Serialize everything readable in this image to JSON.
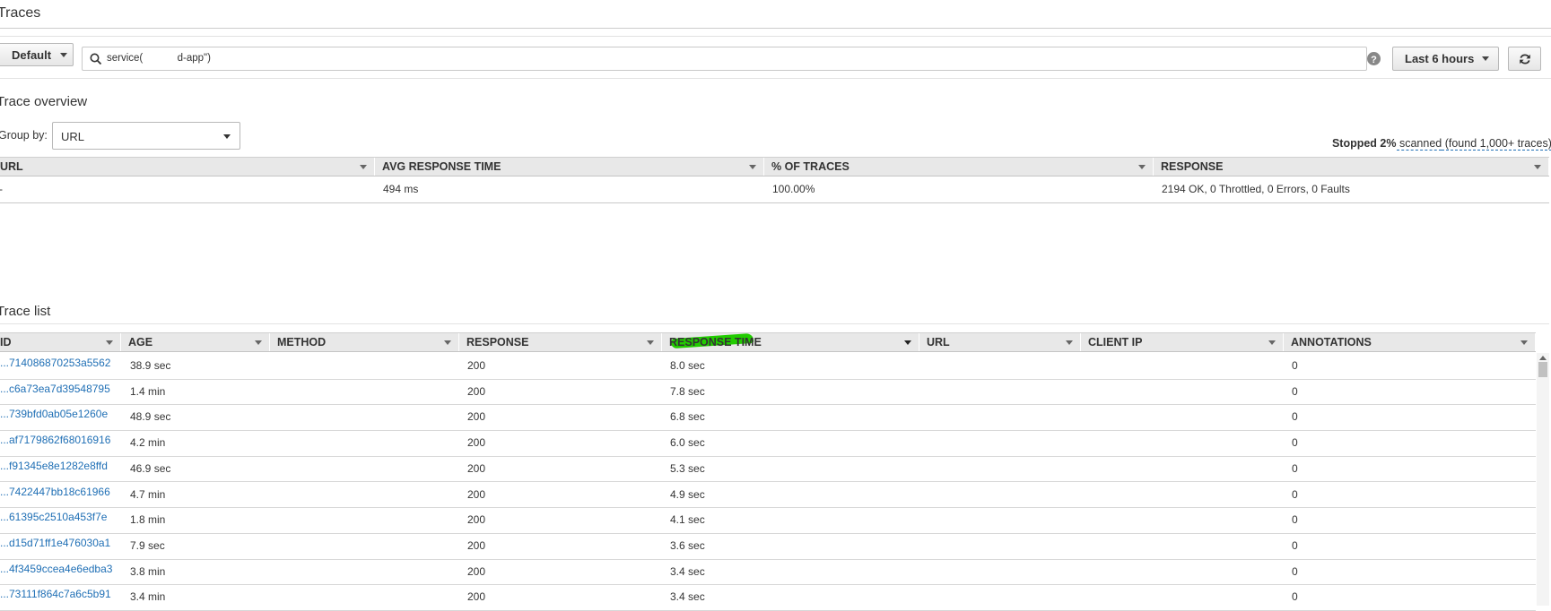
{
  "page": {
    "title": "Traces"
  },
  "toolbar": {
    "group_label": "Default",
    "query": "service(            d-app\")",
    "time_range": "Last 6 hours"
  },
  "overview": {
    "title": "Trace overview",
    "group_by_label": "Group by:",
    "group_by_value": "URL",
    "status_prefix": "Stopped ",
    "status_percent": "2%",
    "status_scanned": " scanned",
    "status_found": " (found 1,000+ traces)",
    "columns": [
      "URL",
      "AVG RESPONSE TIME",
      "% OF TRACES",
      "RESPONSE"
    ],
    "row": {
      "url": "-",
      "avg_response_time": "494 ms",
      "percent_of_traces": "100.00%",
      "response": "2194 OK, 0 Throttled, 0 Errors, 0 Faults"
    }
  },
  "trace_list": {
    "title": "Trace list",
    "columns": [
      "ID",
      "AGE",
      "METHOD",
      "RESPONSE",
      "RESPONSE TIME",
      "URL",
      "CLIENT IP",
      "ANNOTATIONS"
    ],
    "rows": [
      {
        "id": "...714086870253a5562",
        "age": "38.9 sec",
        "method": "",
        "response": "200",
        "response_time": "8.0 sec",
        "url": "",
        "client_ip": "",
        "annotations": "0"
      },
      {
        "id": "...c6a73ea7d39548795",
        "age": "1.4 min",
        "method": "",
        "response": "200",
        "response_time": "7.8 sec",
        "url": "",
        "client_ip": "",
        "annotations": "0"
      },
      {
        "id": "...739bfd0ab05e1260e",
        "age": "48.9 sec",
        "method": "",
        "response": "200",
        "response_time": "6.8 sec",
        "url": "",
        "client_ip": "",
        "annotations": "0"
      },
      {
        "id": "...af7179862f68016916",
        "age": "4.2 min",
        "method": "",
        "response": "200",
        "response_time": "6.0 sec",
        "url": "",
        "client_ip": "",
        "annotations": "0"
      },
      {
        "id": "...f91345e8e1282e8ffd",
        "age": "46.9 sec",
        "method": "",
        "response": "200",
        "response_time": "5.3 sec",
        "url": "",
        "client_ip": "",
        "annotations": "0"
      },
      {
        "id": "...7422447bb18c61966",
        "age": "4.7 min",
        "method": "",
        "response": "200",
        "response_time": "4.9 sec",
        "url": "",
        "client_ip": "",
        "annotations": "0"
      },
      {
        "id": "...61395c2510a453f7e",
        "age": "1.8 min",
        "method": "",
        "response": "200",
        "response_time": "4.1 sec",
        "url": "",
        "client_ip": "",
        "annotations": "0"
      },
      {
        "id": "...d15d71ff1e476030a1",
        "age": "7.9 sec",
        "method": "",
        "response": "200",
        "response_time": "3.6 sec",
        "url": "",
        "client_ip": "",
        "annotations": "0"
      },
      {
        "id": "...4f3459ccea4e6edba3",
        "age": "3.8 min",
        "method": "",
        "response": "200",
        "response_time": "3.4 sec",
        "url": "",
        "client_ip": "",
        "annotations": "0"
      },
      {
        "id": "...73111f864c7a6c5b91",
        "age": "3.4 min",
        "method": "",
        "response": "200",
        "response_time": "3.4 sec",
        "url": "",
        "client_ip": "",
        "annotations": "0"
      }
    ]
  },
  "icons": {
    "search": "search-icon",
    "help": "help-icon",
    "refresh": "refresh-icon",
    "dropdown": "chevron-down-icon"
  },
  "colors": {
    "link": "#1f6fb5",
    "highlight": "#22cc00"
  }
}
